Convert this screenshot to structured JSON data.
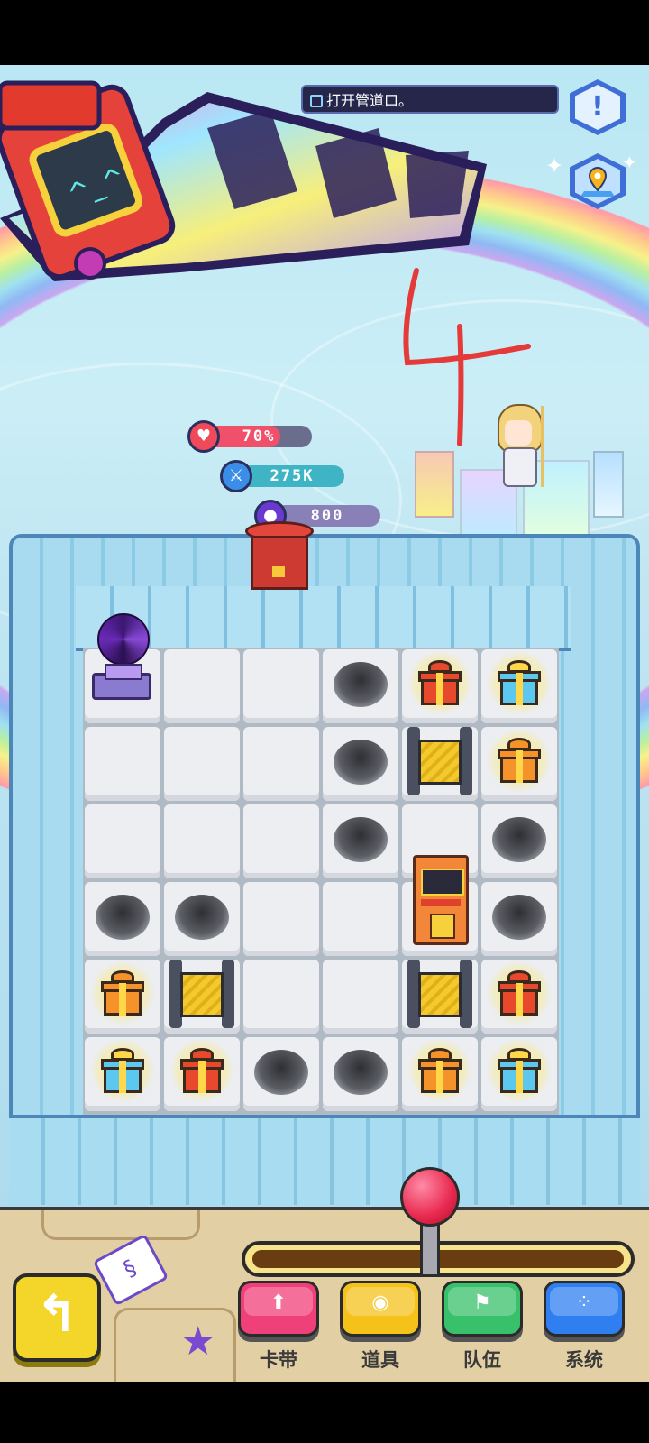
{
  "quest": {
    "text": "打开管道口。"
  },
  "stats": {
    "health": {
      "value": "70%",
      "fraction": 0.7,
      "icon": "heart-icon"
    },
    "attack": {
      "value": "275K",
      "icon": "sword-icon"
    },
    "points": {
      "value": "800",
      "icon": "orb-icon"
    }
  },
  "overlay_number": "4",
  "right_buttons": [
    {
      "icon": "alert-icon"
    },
    {
      "icon": "map-pin-icon"
    }
  ],
  "board": {
    "rows": 6,
    "cols": 6,
    "cells": [
      [
        "portal",
        "floor",
        "floor",
        "hole",
        "gift-red",
        "gift-blue"
      ],
      [
        "floor",
        "floor",
        "floor",
        "hole",
        "gate",
        "gift-orange"
      ],
      [
        "floor",
        "floor",
        "floor",
        "hole",
        "floor",
        "hole"
      ],
      [
        "hole",
        "hole",
        "floor",
        "floor",
        "arcade",
        "hole"
      ],
      [
        "gift-orange",
        "gate",
        "floor",
        "floor",
        "gate",
        "gift-red"
      ],
      [
        "gift-blue",
        "gift-red",
        "hole",
        "hole",
        "gift-orange",
        "gift-blue"
      ]
    ]
  },
  "nav": [
    {
      "label": "卡带",
      "icon": "up-arrow-icon",
      "color": "#f0407a"
    },
    {
      "label": "道具",
      "icon": "bag-icon",
      "color": "#f5c21a"
    },
    {
      "label": "队伍",
      "icon": "flag-icon",
      "color": "#38c06a"
    },
    {
      "label": "系统",
      "icon": "grid-dots-icon",
      "color": "#2f7ff0"
    }
  ],
  "colors": {
    "gift_red": "#e8482c",
    "gift_orange": "#f5922a",
    "gift_blue": "#5cc8f0"
  }
}
